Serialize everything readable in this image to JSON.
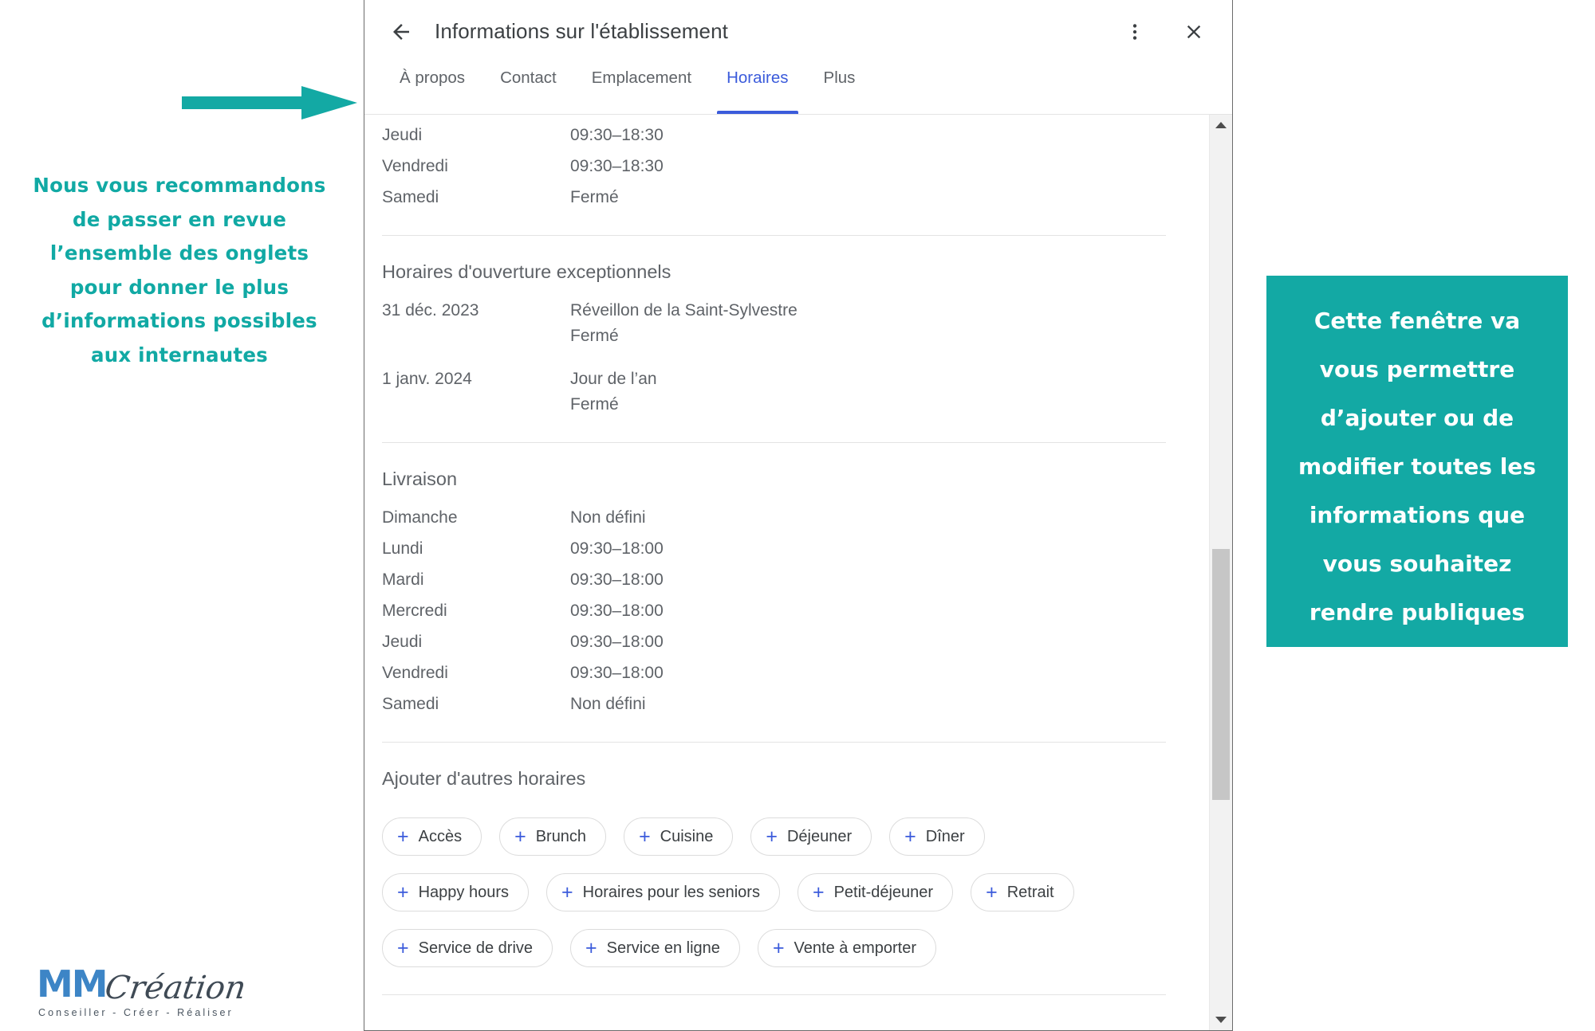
{
  "annotations": {
    "left_note_lines": [
      "Nous vous recommandons",
      "de passer en revue",
      "l’ensemble des onglets",
      "pour donner le plus",
      "d’informations possibles",
      "aux internautes"
    ],
    "right_callout_lines": [
      "Cette fenêtre va",
      "vous permettre",
      "d’ajouter ou de",
      "modifier toutes les",
      "informations que",
      "vous souhaitez",
      "rendre publiques"
    ],
    "accent_color": "#13a9a4"
  },
  "logo": {
    "mark": "MM",
    "word": "Création",
    "tagline": "Conseiller  -  Créer  -  Réaliser",
    "mark_color": "#3d85c6",
    "word_color": "#3f4a55"
  },
  "dialog": {
    "title": "Informations sur l'établissement",
    "back_icon": "arrow-left-icon",
    "more_icon": "more-vertical-icon",
    "close_icon": "close-icon",
    "tabs": [
      {
        "label": "À propos",
        "active": false
      },
      {
        "label": "Contact",
        "active": false
      },
      {
        "label": "Emplacement",
        "active": false
      },
      {
        "label": "Horaires",
        "active": true
      },
      {
        "label": "Plus",
        "active": false
      }
    ],
    "active_tab_color": "#3b5bdb",
    "opening_hours": [
      {
        "day": "Jeudi",
        "value": "09:30–18:30"
      },
      {
        "day": "Vendredi",
        "value": "09:30–18:30"
      },
      {
        "day": "Samedi",
        "value": "Fermé"
      }
    ],
    "special_hours": {
      "title": "Horaires d'ouverture exceptionnels",
      "entries": [
        {
          "date": "31 déc. 2023",
          "name": "Réveillon de la Saint-Sylvestre",
          "status": "Fermé"
        },
        {
          "date": "1 janv. 2024",
          "name": "Jour de l’an",
          "status": "Fermé"
        }
      ]
    },
    "delivery": {
      "title": "Livraison",
      "rows": [
        {
          "day": "Dimanche",
          "value": "Non défini"
        },
        {
          "day": "Lundi",
          "value": "09:30–18:00"
        },
        {
          "day": "Mardi",
          "value": "09:30–18:00"
        },
        {
          "day": "Mercredi",
          "value": "09:30–18:00"
        },
        {
          "day": "Jeudi",
          "value": "09:30–18:00"
        },
        {
          "day": "Vendredi",
          "value": "09:30–18:00"
        },
        {
          "day": "Samedi",
          "value": "Non défini"
        }
      ]
    },
    "add_hours": {
      "title": "Ajouter d'autres horaires",
      "rows": [
        [
          "Accès",
          "Brunch",
          "Cuisine",
          "Déjeuner",
          "Dîner"
        ],
        [
          "Happy hours",
          "Horaires pour les seniors",
          "Petit-déjeuner",
          "Retrait"
        ],
        [
          "Service de drive",
          "Service en ligne",
          "Vente à emporter"
        ]
      ],
      "plus_glyph": "+"
    },
    "scrollbar": {
      "up_arrow": "caret-up-icon",
      "down_arrow": "caret-down-icon"
    }
  }
}
